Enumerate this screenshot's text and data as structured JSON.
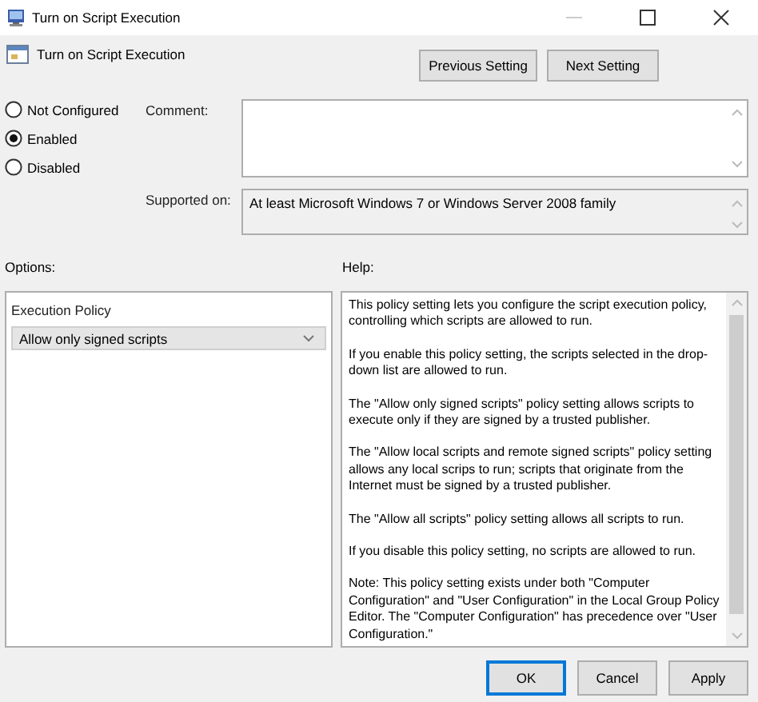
{
  "window": {
    "title": "Turn on Script Execution"
  },
  "header": {
    "title": "Turn on Script Execution",
    "buttons": [
      {
        "label": "Previous Setting"
      },
      {
        "label": "Next Setting"
      }
    ]
  },
  "state_options": [
    {
      "label": "Not Configured",
      "selected": false
    },
    {
      "label": "Enabled",
      "selected": true
    },
    {
      "label": "Disabled",
      "selected": false
    }
  ],
  "comment": {
    "label": "Comment:"
  },
  "supported_on": {
    "label": "Supported on:",
    "value": "At least Microsoft Windows 7 or Windows Server 2008 family"
  },
  "options": {
    "label": "Options:",
    "policy_label": "Execution Policy",
    "dropdown": {
      "value": "Allow only signed scripts"
    }
  },
  "help": {
    "label": "Help:",
    "paragraphs": [
      "This policy setting lets you configure the script execution policy, controlling which scripts are allowed to run.",
      "If you enable this policy setting, the scripts selected in the drop-down list are allowed to run.",
      "The \"Allow only signed scripts\" policy setting allows scripts to execute only if they are signed by a trusted publisher.",
      "The \"Allow local scripts and remote signed scripts\" policy setting allows any local scrips to run; scripts that originate from the Internet must be signed by a trusted publisher.",
      "The \"Allow all scripts\" policy setting allows all scripts to run.",
      "If you disable this policy setting, no scripts are allowed to run.",
      "Note: This policy setting exists under both \"Computer Configuration\" and \"User Configuration\" in the Local Group Policy Editor. The \"Computer Configuration\" has precedence over \"User Configuration.\""
    ]
  },
  "buttons": [
    {
      "label": "OK",
      "focused": true
    },
    {
      "label": "Cancel",
      "focused": false
    },
    {
      "label": "Apply",
      "focused": false
    }
  ]
}
